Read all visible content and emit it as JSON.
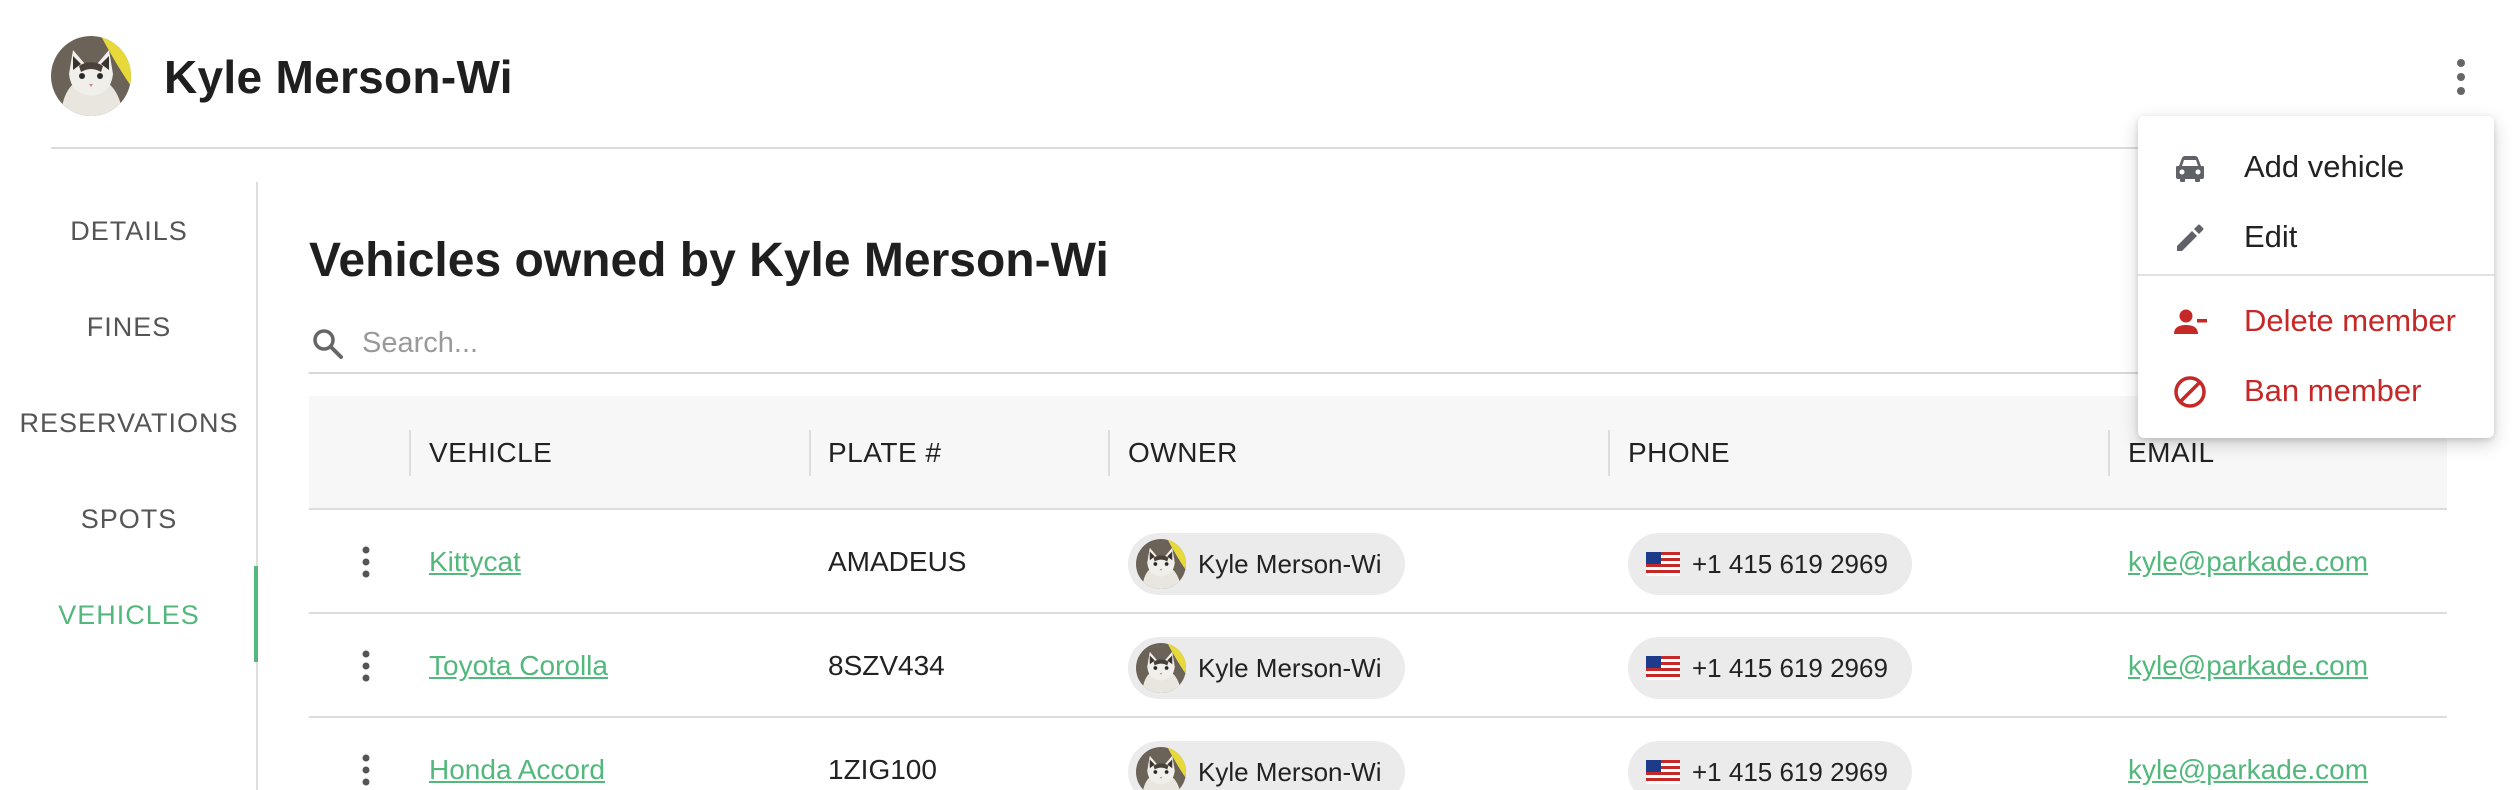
{
  "header": {
    "title": "Kyle Merson-Wi",
    "avatar_icon": "cat-avatar",
    "more_icon": "more-vertical-icon"
  },
  "sidebar": {
    "items": [
      {
        "label": "DETAILS",
        "active": false
      },
      {
        "label": "FINES",
        "active": false
      },
      {
        "label": "RESERVATIONS",
        "active": false
      },
      {
        "label": "SPOTS",
        "active": false
      },
      {
        "label": "VEHICLES",
        "active": true
      }
    ],
    "accent_color": "#52b87c"
  },
  "main": {
    "title": "Vehicles owned by Kyle Merson-Wi",
    "search": {
      "placeholder": "Search...",
      "value": ""
    }
  },
  "table": {
    "columns": [
      "VEHICLE",
      "PLATE #",
      "OWNER",
      "PHONE",
      "EMAIL"
    ],
    "rows": [
      {
        "vehicle": "Kittycat",
        "plate": "AMADEUS",
        "owner": "Kyle Merson-Wi",
        "phone": "+1 415 619 2969",
        "email": "kyle@parkade.com"
      },
      {
        "vehicle": "Toyota Corolla",
        "plate": "8SZV434",
        "owner": "Kyle Merson-Wi",
        "phone": "+1 415 619 2969",
        "email": "kyle@parkade.com"
      },
      {
        "vehicle": "Honda Accord",
        "plate": "1ZIG100",
        "owner": "Kyle Merson-Wi",
        "phone": "+1 415 619 2969",
        "email": "kyle@parkade.com"
      }
    ]
  },
  "menu": {
    "items": [
      {
        "label": "Add vehicle",
        "icon": "car-icon",
        "color": "#222222"
      },
      {
        "label": "Edit",
        "icon": "pencil-icon",
        "color": "#222222"
      },
      {
        "label": "Delete member",
        "icon": "person-remove-icon",
        "color": "#c62828"
      },
      {
        "label": "Ban member",
        "icon": "block-icon",
        "color": "#c62828"
      }
    ]
  },
  "colors": {
    "accent": "#52b87c",
    "danger": "#c62828",
    "chip_bg": "#ebebeb"
  }
}
